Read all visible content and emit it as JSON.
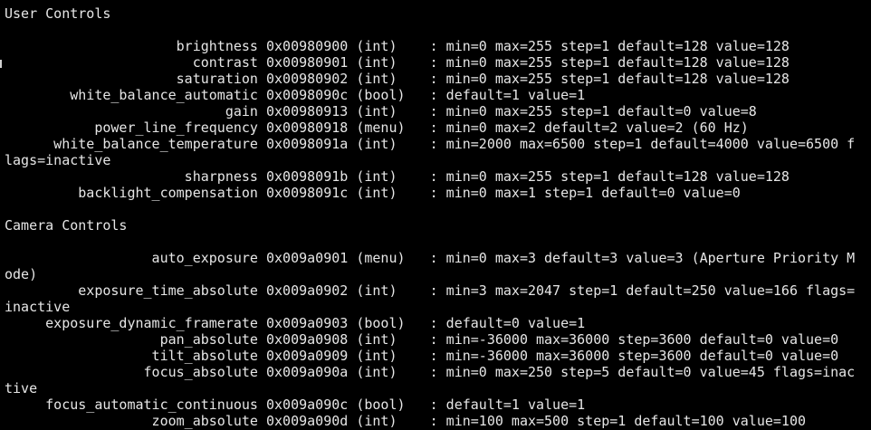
{
  "terminal": {
    "lines": [
      "User Controls",
      "",
      "                     brightness 0x00980900 (int)    : min=0 max=255 step=1 default=128 value=128",
      "                       contrast 0x00980901 (int)    : min=0 max=255 step=1 default=128 value=128",
      "                     saturation 0x00980902 (int)    : min=0 max=255 step=1 default=128 value=128",
      "        white_balance_automatic 0x0098090c (bool)   : default=1 value=1",
      "                           gain 0x00980913 (int)    : min=0 max=255 step=1 default=0 value=8",
      "           power_line_frequency 0x00980918 (menu)   : min=0 max=2 default=2 value=2 (60 Hz)",
      "      white_balance_temperature 0x0098091a (int)    : min=2000 max=6500 step=1 default=4000 value=6500 f",
      "lags=inactive",
      "                      sharpness 0x0098091b (int)    : min=0 max=255 step=1 default=128 value=128",
      "         backlight_compensation 0x0098091c (int)    : min=0 max=1 step=1 default=0 value=0",
      "",
      "Camera Controls",
      "",
      "                  auto_exposure 0x009a0901 (menu)   : min=0 max=3 default=3 value=3 (Aperture Priority M",
      "ode)",
      "         exposure_time_absolute 0x009a0902 (int)    : min=3 max=2047 step=1 default=250 value=166 flags=",
      "inactive",
      "     exposure_dynamic_framerate 0x009a0903 (bool)   : default=0 value=1",
      "                   pan_absolute 0x009a0908 (int)    : min=-36000 max=36000 step=3600 default=0 value=0",
      "                  tilt_absolute 0x009a0909 (int)    : min=-36000 max=36000 step=3600 default=0 value=0",
      "                 focus_absolute 0x009a090a (int)    : min=0 max=250 step=5 default=0 value=45 flags=inac",
      "tive",
      "     focus_automatic_continuous 0x009a090c (bool)   : default=1 value=1",
      "                  zoom_absolute 0x009a090d (int)    : min=100 max=500 step=1 default=100 value=100"
    ]
  }
}
